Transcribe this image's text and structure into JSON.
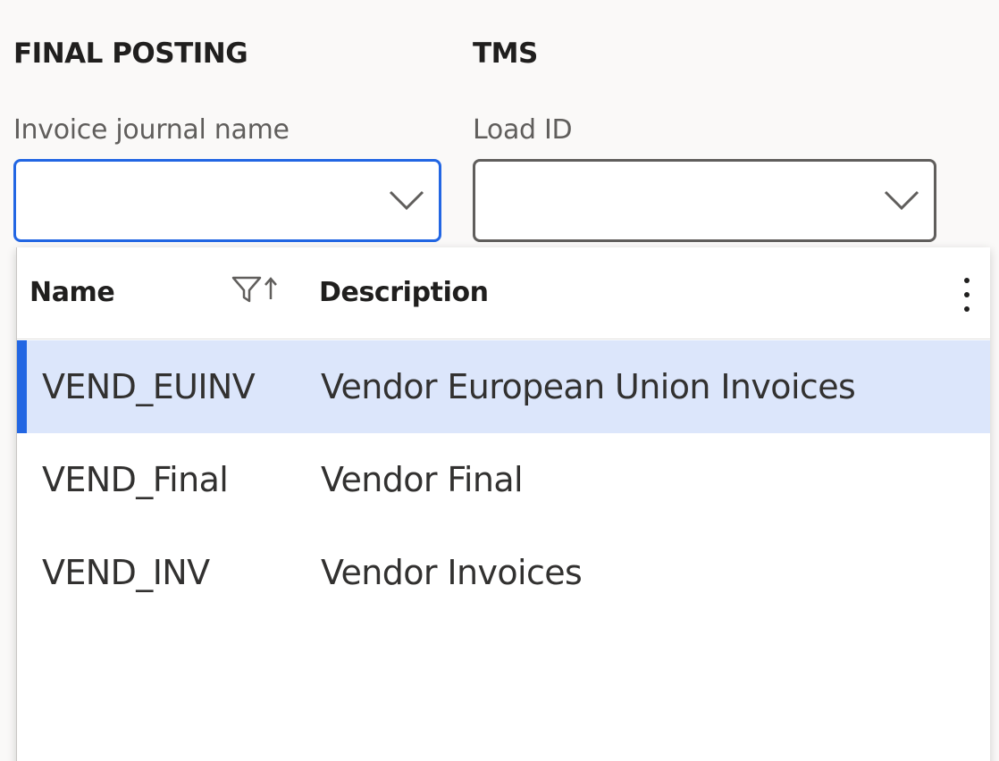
{
  "sections": {
    "final_posting": {
      "title": "FINAL POSTING",
      "field_label": "Invoice journal name",
      "value": ""
    },
    "tms": {
      "title": "TMS",
      "field_label": "Load ID",
      "value": ""
    }
  },
  "dropdown": {
    "columns": {
      "name": "Name",
      "description": "Description"
    },
    "rows": [
      {
        "name": "VEND_EUINV",
        "description": "Vendor European Union Invoices",
        "selected": true
      },
      {
        "name": "VEND_Final",
        "description": "Vendor Final",
        "selected": false
      },
      {
        "name": "VEND_INV",
        "description": "Vendor Invoices",
        "selected": false
      }
    ]
  },
  "colors": {
    "accent": "#2266e3",
    "selected_row": "#dce6fb",
    "background": "#faf9f8"
  },
  "icons": {
    "combo_toggle": "chevron-down-icon",
    "filter_sort": "filter-sort-icon",
    "more": "more-vertical-icon"
  }
}
